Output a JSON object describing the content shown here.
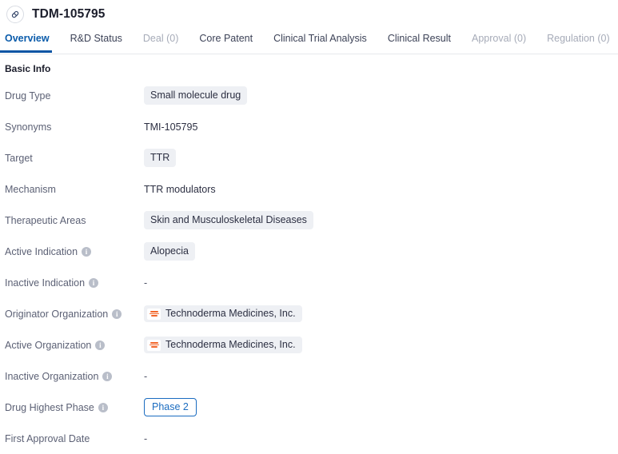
{
  "header": {
    "icon": "pill-capsule-icon",
    "title": "TDM-105795"
  },
  "tabs": [
    {
      "label": "Overview",
      "active": true,
      "muted": false
    },
    {
      "label": "R&D Status",
      "active": false,
      "muted": false
    },
    {
      "label": "Deal (0)",
      "active": false,
      "muted": true
    },
    {
      "label": "Core Patent",
      "active": false,
      "muted": false
    },
    {
      "label": "Clinical Trial Analysis",
      "active": false,
      "muted": false
    },
    {
      "label": "Clinical Result",
      "active": false,
      "muted": false
    },
    {
      "label": "Approval (0)",
      "active": false,
      "muted": true
    },
    {
      "label": "Regulation (0)",
      "active": false,
      "muted": true
    }
  ],
  "section": {
    "title": "Basic Info"
  },
  "rows": [
    {
      "label": "Drug Type",
      "info": false,
      "type": "chip",
      "value": "Small molecule drug"
    },
    {
      "label": "Synonyms",
      "info": false,
      "type": "plain",
      "value": "TMI-105795"
    },
    {
      "label": "Target",
      "info": false,
      "type": "chip",
      "value": "TTR"
    },
    {
      "label": "Mechanism",
      "info": false,
      "type": "plain",
      "value": "TTR modulators"
    },
    {
      "label": "Therapeutic Areas",
      "info": false,
      "type": "chip",
      "value": "Skin and Musculoskeletal Diseases"
    },
    {
      "label": "Active Indication",
      "info": true,
      "type": "chip",
      "value": "Alopecia"
    },
    {
      "label": "Inactive Indication",
      "info": true,
      "type": "dash",
      "value": "-"
    },
    {
      "label": "Originator Organization",
      "info": true,
      "type": "org",
      "value": "Technoderma Medicines, Inc."
    },
    {
      "label": "Active Organization",
      "info": true,
      "type": "org",
      "value": "Technoderma Medicines, Inc."
    },
    {
      "label": "Inactive Organization",
      "info": true,
      "type": "dash",
      "value": "-"
    },
    {
      "label": "Drug Highest Phase",
      "info": true,
      "type": "phase",
      "value": "Phase 2"
    },
    {
      "label": "First Approval Date",
      "info": false,
      "type": "dash",
      "value": "-"
    }
  ],
  "colors": {
    "accent": "#0b55a4",
    "phase_badge": "#1b6cc0",
    "chip_bg": "#eef0f4",
    "label_text": "#5c6175",
    "org_logo": "#f2662a"
  },
  "icons": {
    "info": "i"
  }
}
